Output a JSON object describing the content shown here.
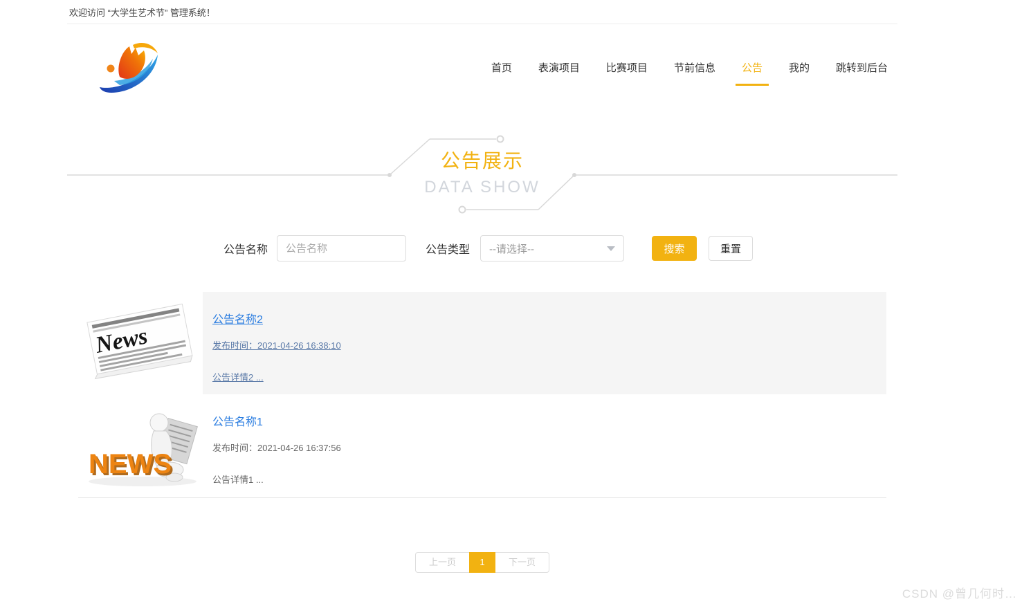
{
  "welcome_bar": {
    "text": "欢迎访问 “大学生艺术节” 管理系统！"
  },
  "nav": {
    "items": [
      {
        "label": "首页",
        "active": false
      },
      {
        "label": "表演项目",
        "active": false
      },
      {
        "label": "比赛项目",
        "active": false
      },
      {
        "label": "节前信息",
        "active": false
      },
      {
        "label": "公告",
        "active": true
      },
      {
        "label": "我的",
        "active": false
      },
      {
        "label": "跳转到后台",
        "active": false
      }
    ]
  },
  "hero": {
    "title": "公告展示",
    "subtitle": "DATA SHOW"
  },
  "search": {
    "name_label": "公告名称",
    "name_placeholder": "公告名称",
    "name_value": "",
    "type_label": "公告类型",
    "type_selected": "--请选择--",
    "search_button": "搜索",
    "reset_button": "重置"
  },
  "announcements": [
    {
      "title": "公告名称2",
      "publish_time": "发布时间：2021-04-26 16:38:10",
      "detail": "公告详情2 ...",
      "image": "newspaper-news",
      "image_text": "News",
      "state": "hovered"
    },
    {
      "title": "公告名称1",
      "publish_time": "发布时间：2021-04-26 16:37:56",
      "detail": "公告详情1 ...",
      "image": "figure-reading-news",
      "image_text": "NEWS",
      "state": "plain"
    }
  ],
  "pagination": {
    "prev_label": "上一页",
    "current_page": "1",
    "next_label": "下一页"
  },
  "watermark": {
    "text": "CSDN @曾几何时…"
  },
  "colors": {
    "accent_gold": "#F2B211",
    "link_blue": "#2B7DE0",
    "hover_link_blue": "#5B7AA8",
    "subtitle_gray": "#D2D6DC",
    "row_hover_bg": "#F5F5F5",
    "disabled_text": "#CCCCCC",
    "news_orange": "#ED8412"
  }
}
